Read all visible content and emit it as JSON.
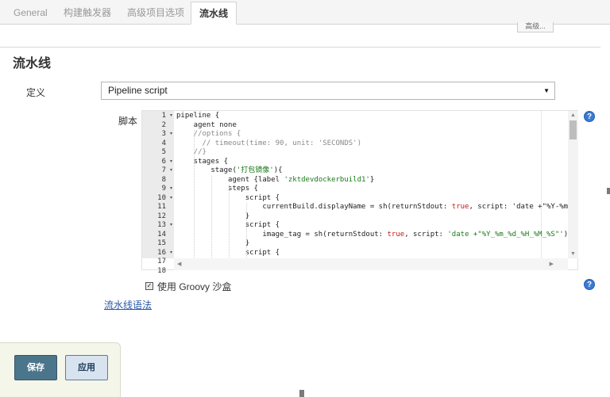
{
  "tabs": [
    {
      "label": "General",
      "active": false
    },
    {
      "label": "构建触发器",
      "active": false
    },
    {
      "label": "高级项目选项",
      "active": false
    },
    {
      "label": "流水线",
      "active": true
    }
  ],
  "partial_button_label": "高级...",
  "section_title": "流水线",
  "definition": {
    "label": "定义",
    "selected": "Pipeline script"
  },
  "script": {
    "label": "脚本",
    "line_numbers": [
      "1",
      "2",
      "3",
      "4",
      "5",
      "6",
      "7",
      "8",
      "9",
      "10",
      "11",
      "12",
      "13",
      "14",
      "15",
      "16",
      "17",
      "18"
    ],
    "folded_lines": [
      "1",
      "3",
      "6",
      "7",
      "9",
      "10",
      "13",
      "16"
    ],
    "lines": [
      "pipeline {",
      "    agent none",
      "    //options {",
      "      // timeout(time: 90, unit: 'SECONDS')",
      "    //}",
      "    stages {",
      "        stage('打包镜像'){",
      "            agent {label 'zktdevdockerbuild1'}",
      "            steps {",
      "                script {",
      "                    currentBuild.displayName = sh(returnStdout: true, script: 'date +\"%Y-%m-%",
      "                }",
      "                script {",
      "                    image_tag = sh(returnStdout: true, script: 'date +\"%Y_%m_%d_%H_%M_%S\"')",
      "                }",
      "                script {",
      "",
      ""
    ]
  },
  "sandbox": {
    "checked": true,
    "label": "使用 Groovy 沙盒"
  },
  "syntax_link": "流水线语法",
  "buttons": {
    "save": "保存",
    "apply": "应用"
  },
  "help_icon_glyph": "?",
  "colors": {
    "save_bg": "#4b758b",
    "apply_bg": "#d7e3ef",
    "link": "#2a59a8",
    "help": "#3a7bd5"
  }
}
